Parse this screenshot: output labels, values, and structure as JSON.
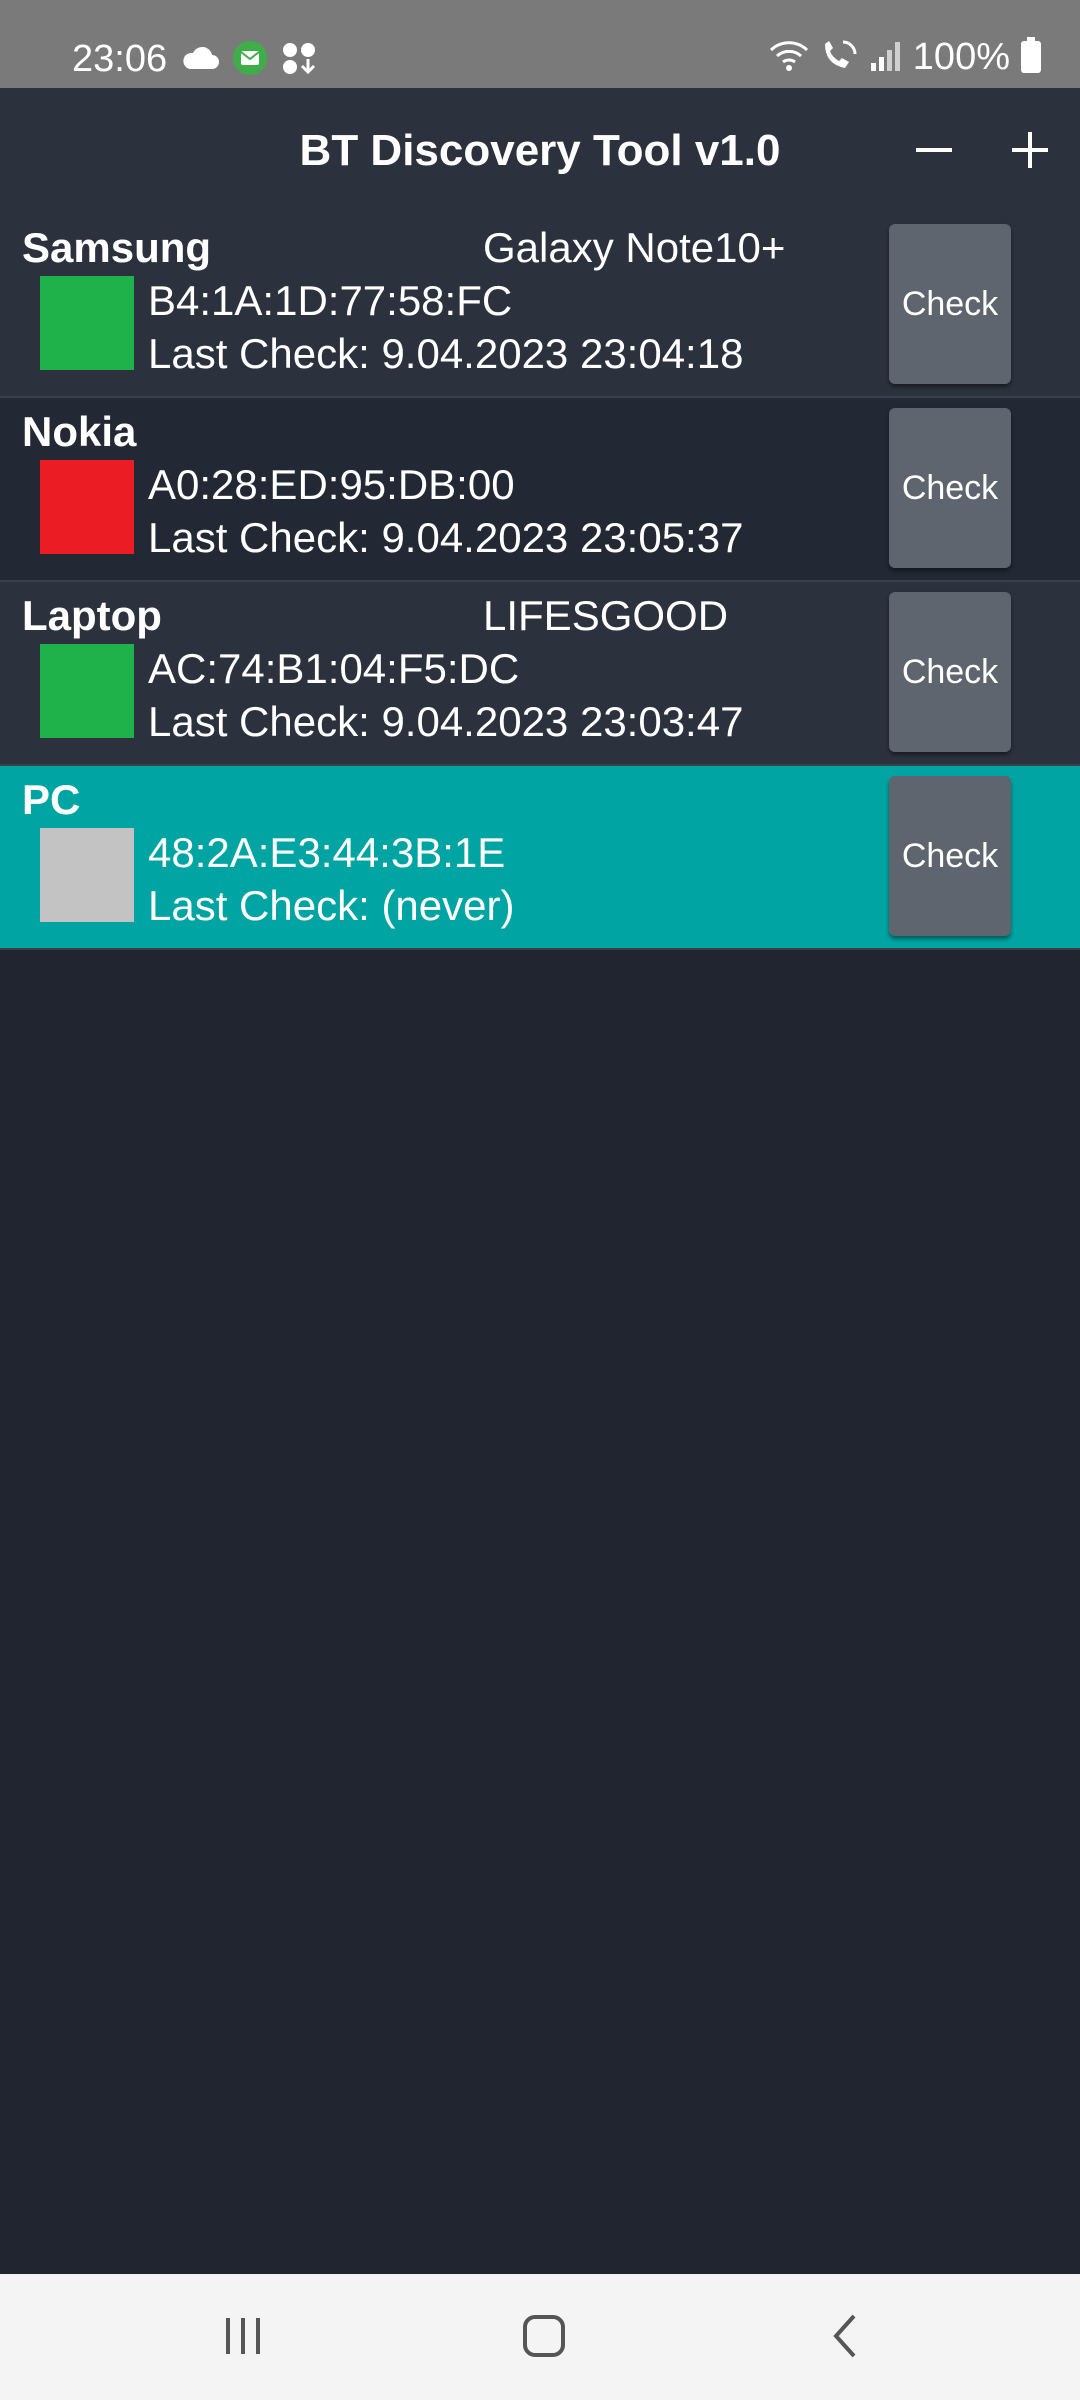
{
  "status_bar": {
    "time": "23:06",
    "battery": "100%",
    "left_icons": [
      "cloud-icon",
      "mail-icon",
      "app-notification-icon"
    ],
    "right_icons": [
      "wifi-icon",
      "wifi-calling-icon",
      "signal-icon",
      "battery-icon"
    ]
  },
  "app_bar": {
    "title": "BT Discovery Tool v1.0",
    "minus_icon": "minus-icon",
    "plus_icon": "plus-icon"
  },
  "devices": [
    {
      "name": "Samsung",
      "model": "Galaxy Note10+",
      "mac": "B4:1A:1D:77:58:FC",
      "last_check": "Last Check: 9.04.2023 23:04:18",
      "status_color": "#1fb14a",
      "button": "Check"
    },
    {
      "name": "Nokia",
      "model": "",
      "mac": "A0:28:ED:95:DB:00",
      "last_check": "Last Check: 9.04.2023 23:05:37",
      "status_color": "#ec1c24",
      "button": "Check"
    },
    {
      "name": "Laptop",
      "model": "LIFESGOOD",
      "mac": "AC:74:B1:04:F5:DC",
      "last_check": "Last Check: 9.04.2023 23:03:47",
      "status_color": "#1fb14a",
      "button": "Check"
    },
    {
      "name": "PC",
      "model": "",
      "mac": "48:2A:E3:44:3B:1E",
      "last_check": "Last Check: (never)",
      "status_color": "#c3c3c3",
      "button": "Check"
    }
  ],
  "colors": {
    "background": "#20252f",
    "row": "#2c323d",
    "row_alt": "#232934",
    "selected_row": "#00a5a3",
    "button": "#5f656e"
  },
  "nav_bar": {
    "recents_icon": "recents-icon",
    "home_icon": "home-icon",
    "back_icon": "back-icon"
  }
}
